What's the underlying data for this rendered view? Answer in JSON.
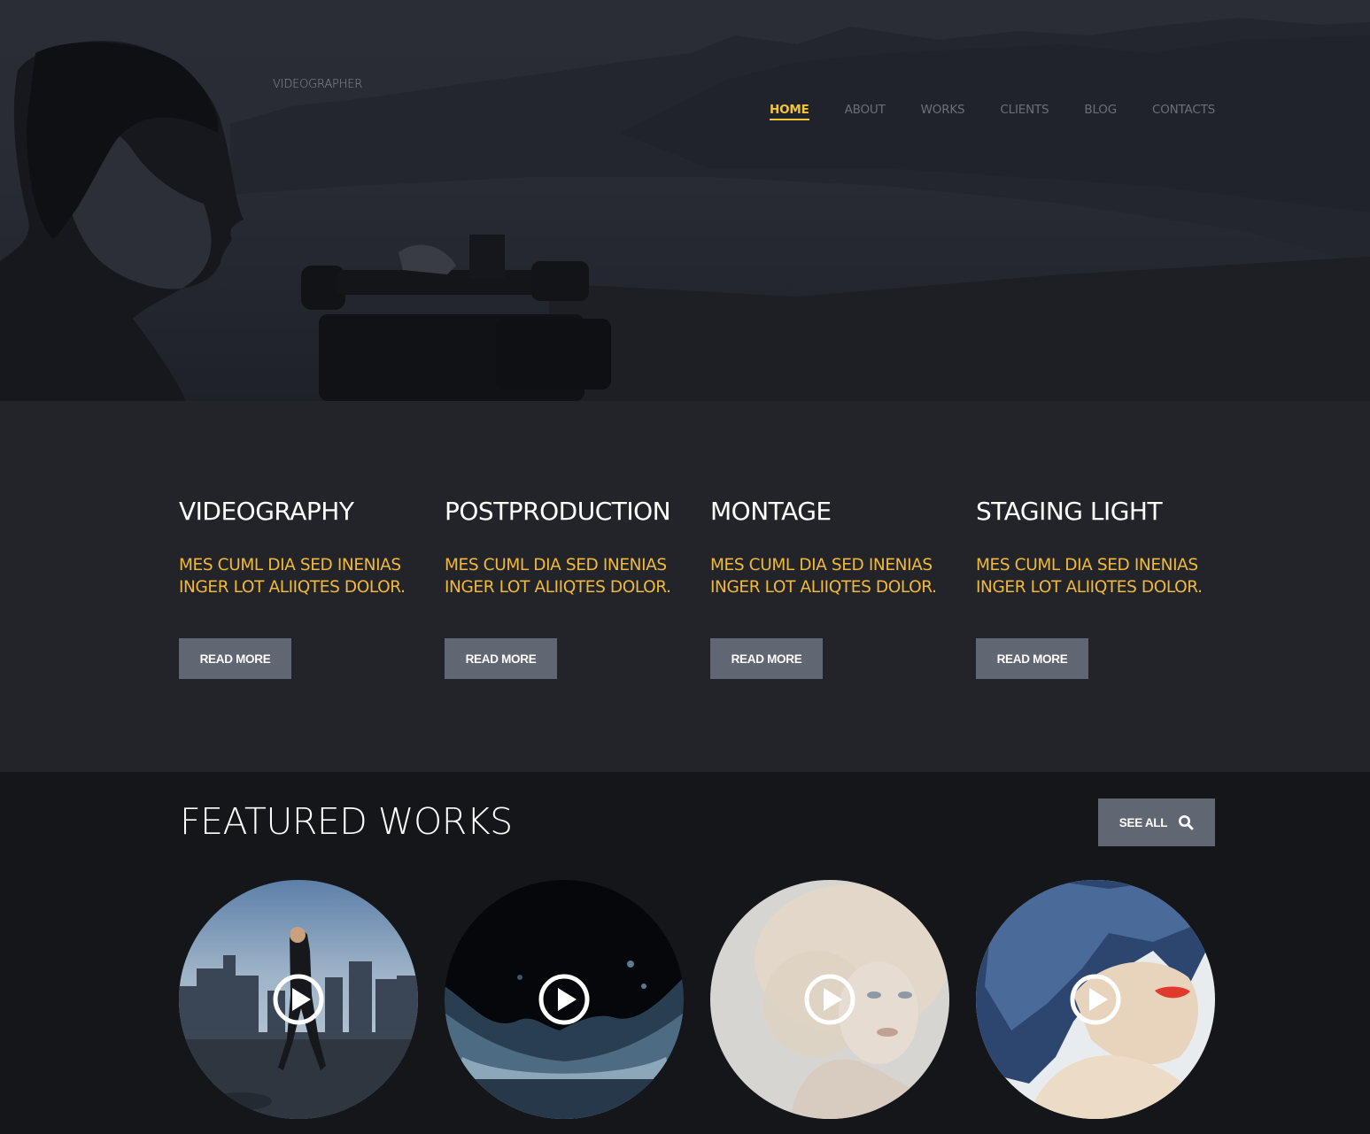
{
  "header": {
    "logo": "VIDEOGRAPHER",
    "nav": [
      {
        "label": "HOME",
        "active": true
      },
      {
        "label": "ABOUT",
        "active": false
      },
      {
        "label": "WORKS",
        "active": false
      },
      {
        "label": "CLIENTS",
        "active": false
      },
      {
        "label": "BLOG",
        "active": false
      },
      {
        "label": "CONTACTS",
        "active": false
      }
    ]
  },
  "services": [
    {
      "title": "VIDEOGRAPHY",
      "line1": "MES CUML DIA SED INENIAS",
      "line2": "INGER LOT ALIIQTES DOLOR.",
      "button": "READ MORE"
    },
    {
      "title": "POSTPRODUCTION",
      "line1": "MES CUML DIA SED INENIAS",
      "line2": "INGER LOT ALIIQTES DOLOR.",
      "button": "READ MORE"
    },
    {
      "title": "MONTAGE",
      "line1": "MES CUML DIA SED INENIAS",
      "line2": "INGER LOT ALIIQTES DOLOR.",
      "button": "READ MORE"
    },
    {
      "title": "STAGING LIGHT",
      "line1": "MES CUML DIA SED INENIAS",
      "line2": "INGER LOT ALIIQTES DOLOR.",
      "button": "READ MORE"
    }
  ],
  "featured": {
    "title": "FEATURED WORKS",
    "see_all": "SEE ALL",
    "see_all_icon": "search-icon",
    "works": [
      {
        "subject": "woman-with-headphones-city-skyline",
        "icon": "play-icon"
      },
      {
        "subject": "water-splash",
        "icon": "play-icon"
      },
      {
        "subject": "blonde-woman-portrait",
        "icon": "play-icon"
      },
      {
        "subject": "woman-blue-feathers",
        "icon": "play-icon"
      }
    ]
  },
  "colors": {
    "accent": "#f0c53c",
    "service_text": "#f0b93a",
    "button_bg": "#606672",
    "hero_bg": "#282b34",
    "services_bg": "#22242a",
    "featured_bg": "#15161a"
  }
}
